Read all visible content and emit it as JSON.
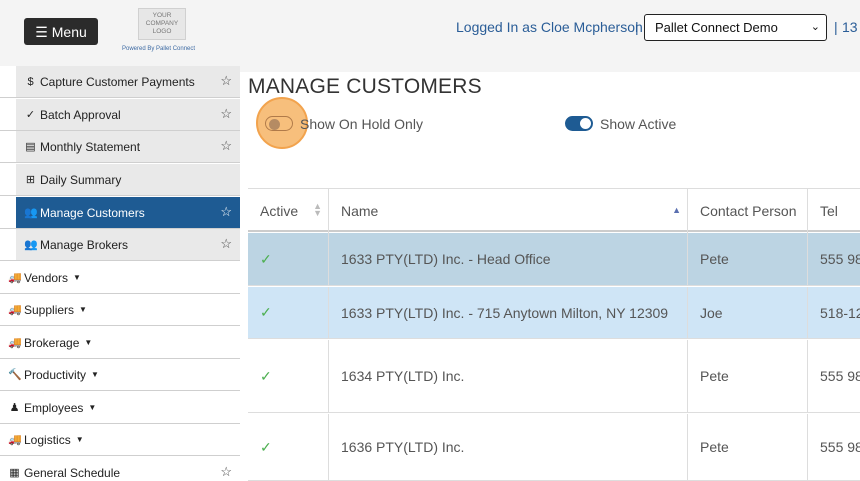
{
  "header": {
    "menu_label": "Menu",
    "logo_lines": [
      "YOUR",
      "COMPANY",
      "LOGO"
    ],
    "powered_by": "Powered By Pallet Connect",
    "logged_in": "Logged In as Cloe Mcpherson",
    "separator": "|",
    "company": "Pallet Connect Demo",
    "extra": "13"
  },
  "sidebar": {
    "items": [
      {
        "label": "Capture Customer Payments",
        "icon": "$"
      },
      {
        "label": "Batch Approval",
        "icon": "✓"
      },
      {
        "label": "Monthly Statement",
        "icon": "▤"
      },
      {
        "label": "Daily Summary",
        "icon": "⊞"
      },
      {
        "label": "Manage Customers",
        "icon": "👥"
      },
      {
        "label": "Manage Brokers",
        "icon": "👥"
      },
      {
        "label": "Vendors",
        "icon": "🚚"
      },
      {
        "label": "Suppliers",
        "icon": "🚚"
      },
      {
        "label": "Brokerage",
        "icon": "🚚"
      },
      {
        "label": "Productivity",
        "icon": "🔨"
      },
      {
        "label": "Employees",
        "icon": "♟"
      },
      {
        "label": "Logistics",
        "icon": "🚚"
      },
      {
        "label": "General Schedule",
        "icon": "▦"
      }
    ]
  },
  "main": {
    "title": "MANAGE CUSTOMERS",
    "toggle_on_hold": "Show On Hold Only",
    "toggle_active": "Show Active",
    "columns": [
      "Active",
      "Name",
      "Contact Person",
      "Tel"
    ],
    "rows": [
      {
        "name": "1633 PTY(LTD) Inc. - Head Office",
        "contact": "Pete",
        "tel": "555 98"
      },
      {
        "name": "1633 PTY(LTD) Inc. - 715 Anytown Milton, NY 12309",
        "contact": "Joe",
        "tel": "518-12"
      },
      {
        "name": "1634 PTY(LTD) Inc.",
        "contact": "Pete",
        "tel": "555 98"
      },
      {
        "name": "1636 PTY(LTD) Inc.",
        "contact": "Pete",
        "tel": "555 98"
      }
    ]
  },
  "colors": {
    "accent": "#1e5b93",
    "highlight": "#f2a34d",
    "check": "#4caf50"
  }
}
